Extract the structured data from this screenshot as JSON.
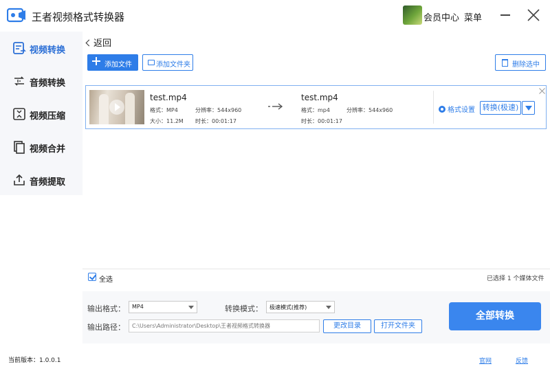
{
  "app": {
    "title": "王者视频格式转换器",
    "accent": "#2e7de8"
  },
  "header": {
    "member_center": "会员中心",
    "menu": "菜单"
  },
  "sidebar": {
    "items": [
      {
        "label": "视频转换",
        "icon": "video-convert-icon",
        "active": true
      },
      {
        "label": "音频转换",
        "icon": "audio-convert-icon",
        "active": false
      },
      {
        "label": "视频压缩",
        "icon": "video-compress-icon",
        "active": false
      },
      {
        "label": "视频合并",
        "icon": "video-merge-icon",
        "active": false
      },
      {
        "label": "音频提取",
        "icon": "audio-extract-icon",
        "active": false
      }
    ]
  },
  "nav": {
    "back": "返回"
  },
  "toolbar": {
    "add_file": "添加文件",
    "add_folder": "添加文件夹",
    "delete_selected": "删除选中"
  },
  "file": {
    "source": {
      "name": "test.mp4",
      "format": "格式：MP4",
      "resolution": "分辨率：544x960",
      "size": "大小：11.2M",
      "duration": "时长：00:01:17"
    },
    "target": {
      "name": "test.mp4",
      "format": "格式：mp4",
      "resolution": "分辨率：544x960",
      "duration": "时长：00:01:17"
    },
    "format_settings": "格式设置",
    "convert_button": "转换(极速)"
  },
  "selection": {
    "select_all": "全选",
    "info": "已选择 1 个媒体文件"
  },
  "output": {
    "format_label": "输出格式：",
    "format_value": "MP4",
    "mode_label": "转换模式：",
    "mode_value": "极速模式(推荐)",
    "path_label": "输出路径：",
    "path_value": "C:\\Users\\Administrator\\Desktop\\王者视频格式转换器",
    "change_dir": "更改目录",
    "open_folder": "打开文件夹",
    "convert_all": "全部转换"
  },
  "status": {
    "version": "当前版本：1.0.0.1",
    "website": "官网",
    "feedback": "反馈"
  }
}
